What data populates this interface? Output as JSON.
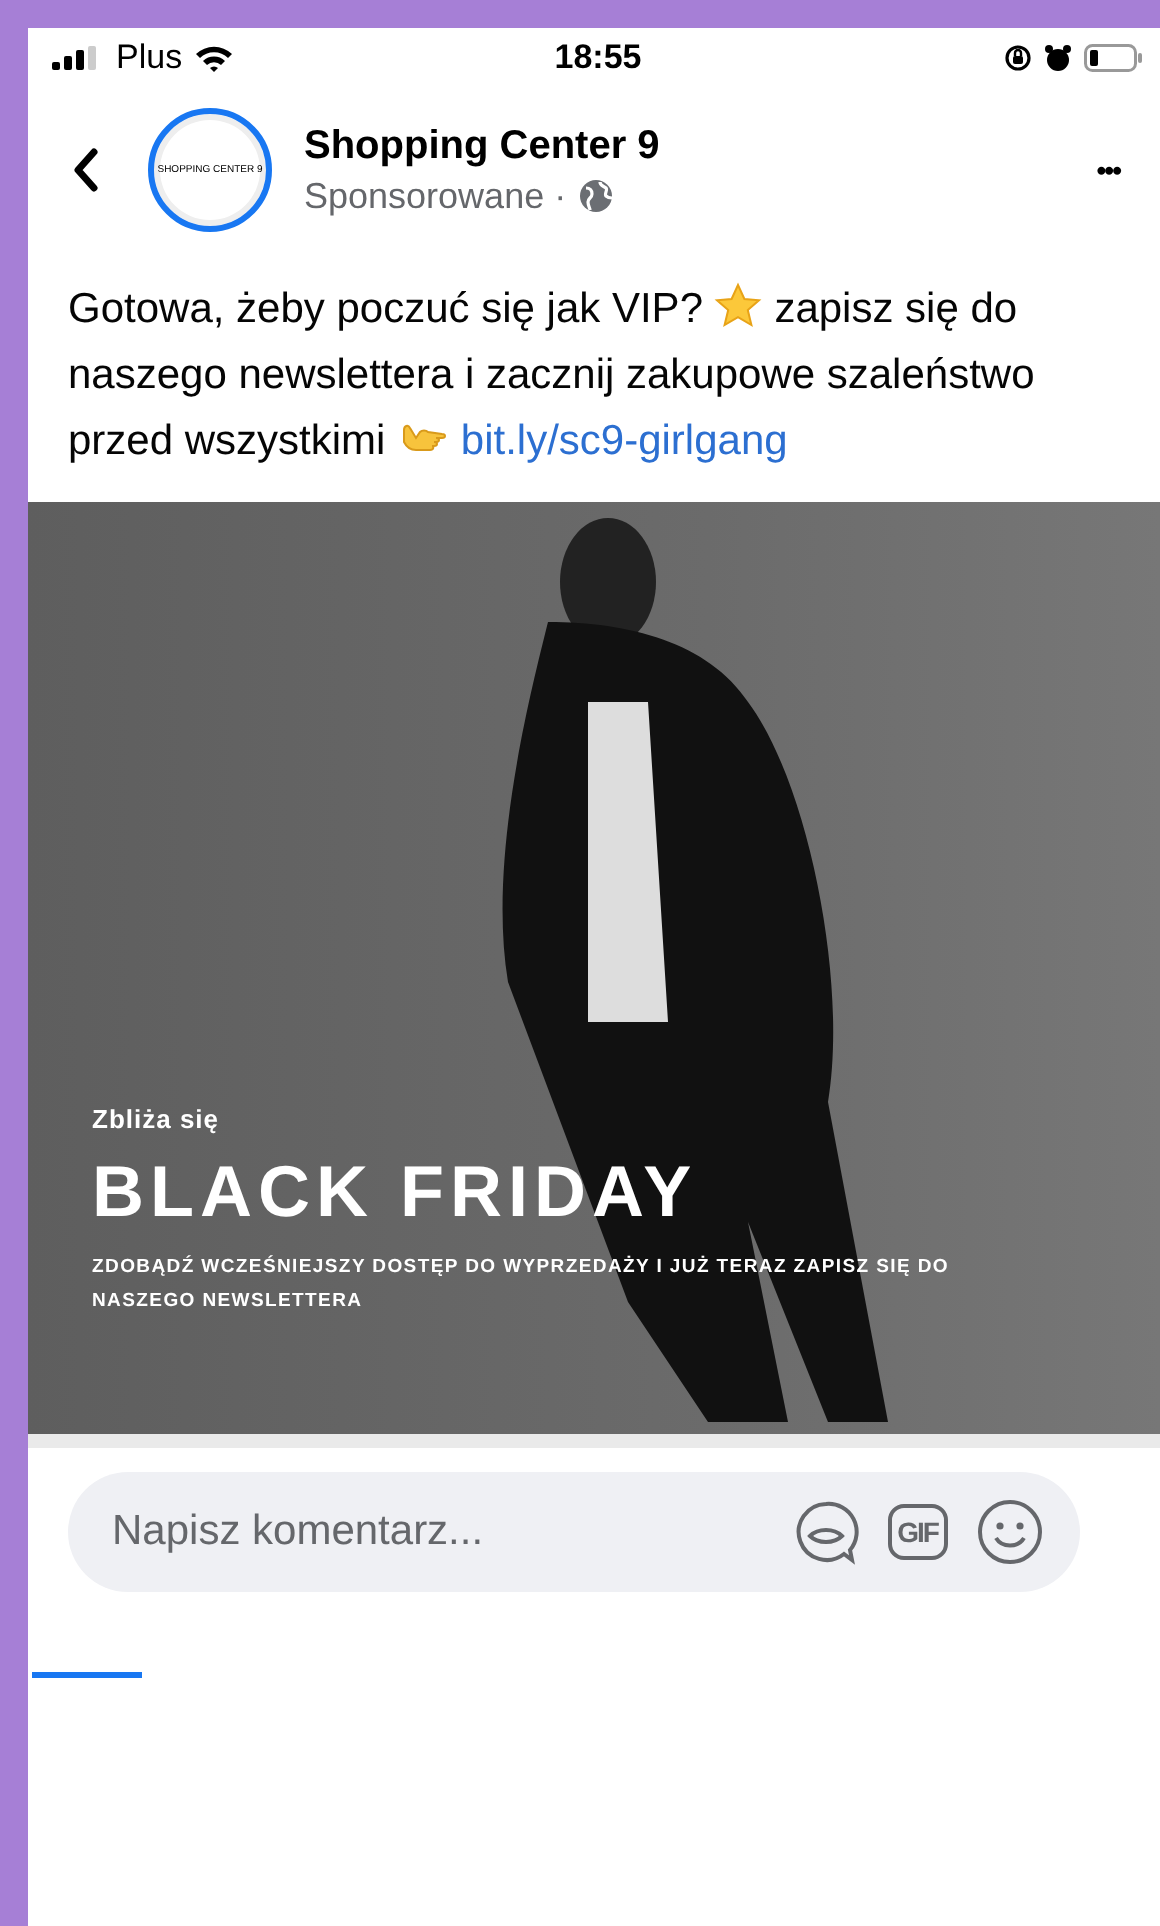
{
  "status_bar": {
    "carrier": "Plus",
    "time": "18:55"
  },
  "post": {
    "page_name": "Shopping Center 9",
    "logo_text": "SHOPPING CENTER 9",
    "subtitle": "Sponsorowane ·",
    "more": "•••",
    "text_parts": [
      {
        "kind": "text",
        "text": "Gotowa, żeby poczuć się jak VIP?"
      },
      {
        "kind": "star"
      },
      {
        "kind": "text",
        "text": "zapisz się do naszego newslettera i zacznij zakupowe szaleństwo przed wszystkimi"
      },
      {
        "kind": "hand"
      },
      {
        "kind": "link",
        "text": "bit.ly/sc9-girlgang"
      }
    ]
  },
  "ad_image": {
    "kicker": "Zbliża się",
    "headline": "BLACK FRIDAY",
    "body": "ZDOBĄDŹ WCZEŚNIEJSZY DOSTĘP DO WYPRZEDAŻY I JUŻ TERAZ ZAPISZ SIĘ DO NASZEGO NEWSLETTERA"
  },
  "comment_bar": {
    "placeholder": "Napisz komentarz...",
    "gif": "GIF"
  }
}
